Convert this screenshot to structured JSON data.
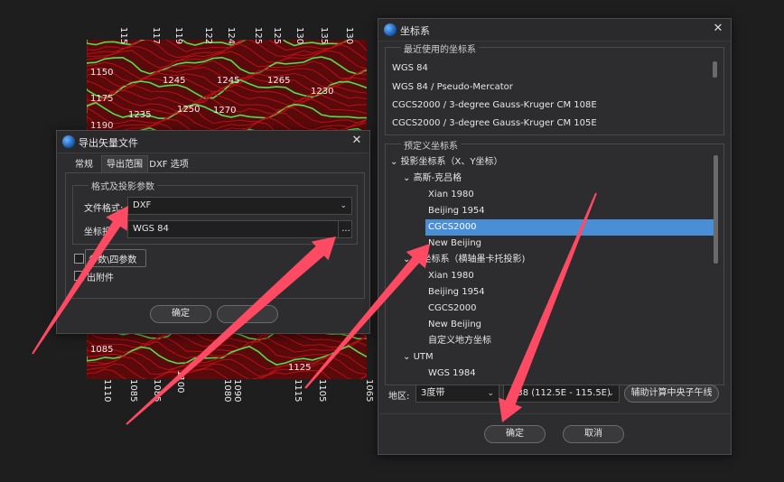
{
  "map": {
    "top_labels": [
      "115",
      "117",
      "119",
      "122",
      "124",
      "125",
      "125",
      "130",
      "135",
      "130"
    ],
    "left_labels": [
      "1150",
      "1175",
      "1190",
      "1085"
    ],
    "inner_labels": [
      "1245",
      "1245",
      "1250",
      "1270",
      "1265",
      "1230",
      "1235",
      "1125"
    ],
    "bottom_labels": [
      "1110",
      "1085",
      "1085",
      "1100",
      "1090",
      "1080",
      "1115",
      "1105",
      "1065"
    ]
  },
  "export_dialog": {
    "title": "导出矢量文件",
    "tabs": [
      "常规",
      "导出范围",
      "DXF 选项"
    ],
    "group_title": "格式及投影参数",
    "format_label": "文件格式:",
    "format_value": "DXF",
    "crs_label": "坐标投",
    "crs_value": "WGS 84",
    "browse_label": "...",
    "param_checkbox_label": "参数\\四参数",
    "attach_checkbox_label": "出附件",
    "ok_label": "确定",
    "cancel_label": ""
  },
  "crs_dialog": {
    "title": "坐标系",
    "recent_title": "最近使用的坐标系",
    "recent_items": [
      "WGS 84",
      "WGS 84 / Pseudo-Mercator",
      "CGCS2000 / 3-degree Gauss-Kruger CM 108E",
      "CGCS2000 / 3-degree Gauss-Kruger CM 105E"
    ],
    "predefined_title": "预定义坐标系",
    "tree": {
      "projected": "投影坐标系（X、Y坐标）",
      "gauss": "高斯-克吕格",
      "gauss_items": [
        "Xian 1980",
        "Beijing 1954",
        "CGCS2000",
        "New Beijing"
      ],
      "local": "方坐标系（横轴墨卡托投影)",
      "local_items": [
        "Xian 1980",
        "Beijing 1954",
        "CGCS2000",
        "New Beijing",
        "自定义地方坐标"
      ],
      "utm": "UTM",
      "utm_items": [
        "WGS 1984"
      ]
    },
    "region_label": "地区:",
    "zone_type": "3度带",
    "zone_value": "e 38 (112.5E - 115.5E)",
    "calc_button": "辅助计算中央子午线",
    "ok_label": "确定",
    "cancel_label": "取消"
  },
  "colors": {
    "contour_red": "#c0101a",
    "contour_green": "#4ee14e",
    "selection": "#4a8fd6",
    "arrow": "#ff4a63"
  }
}
